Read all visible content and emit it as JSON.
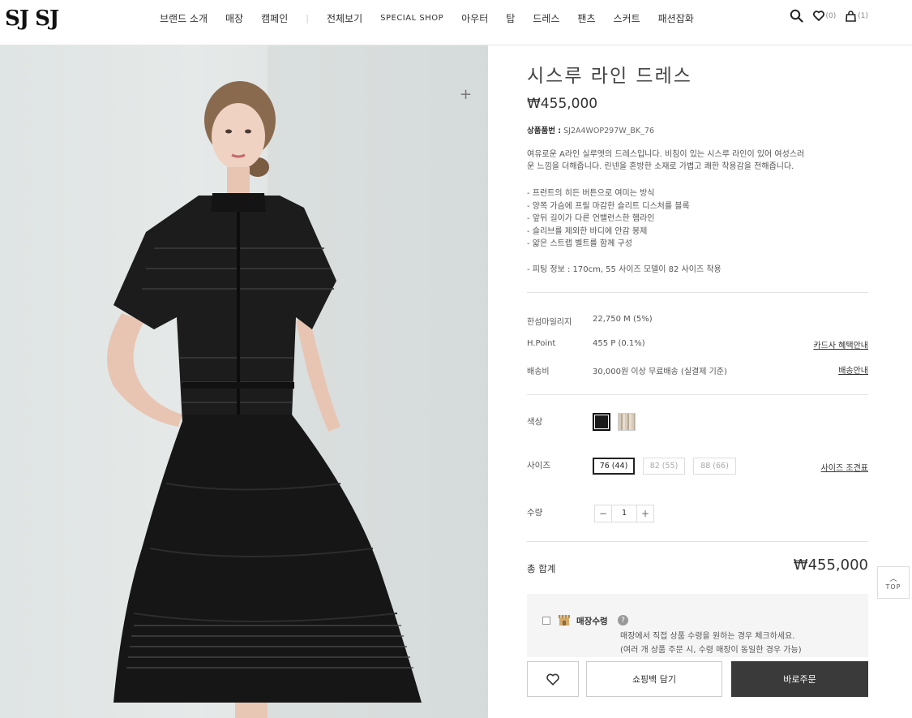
{
  "header": {
    "logo": "SJ SJ",
    "nav": [
      "브랜드 소개",
      "매장",
      "캠페인",
      "전체보기",
      "SPECIAL SHOP",
      "아우터",
      "탑",
      "드레스",
      "팬츠",
      "스커트",
      "패션잡화"
    ],
    "wishlist_count": "(0)",
    "cart_count": "(1)"
  },
  "product": {
    "title": "시스루 라인 드레스",
    "price": "₩455,000",
    "code_label": "상품품번 :",
    "code_value": "SJ2A4WOP297W_BK_76",
    "description": [
      "여유로운 A라인 실루엣의 드레스입니다. 비침이 있는 시스루 라인이 있어 여성스러",
      "운 느낌을 더해줍니다. 린넨을 혼방한 소재로 가볍고 쾌한 착용감을 전해줍니다."
    ],
    "bullets": [
      "- 프런트의 히든 버튼으로 여미는 방식",
      "- 양쪽 가슴에 프릴 마감한 슬리트 디스처를 블록",
      "- 앞뒤 길이가 다른 언밸런스한 헴라인",
      "- 슬리브를 제외한 바디에 안감 봉제",
      "- 얇은 스트랩 벨트를 함께 구성"
    ],
    "fit": "- 피팅 정보 : 170cm, 55 사이즈 모델이 82 사이즈 착용"
  },
  "info": {
    "mileage_label": "한섬마일리지",
    "mileage_value": "22,750 M (5%)",
    "hpoint_label": "H.Point",
    "hpoint_value": "455 P (0.1%)",
    "card_link": "카드사 혜택안내",
    "shipping_label": "배송비",
    "shipping_value": "30,000원 이상 무료배송 (실결제 기준)",
    "shipping_link": "배송안내"
  },
  "options": {
    "color_label": "색상",
    "colors": [
      {
        "name": "black",
        "hex": "#1a1a1a"
      },
      {
        "name": "beige",
        "hex": "#d7cbbb"
      }
    ],
    "size_label": "사이즈",
    "sizes": [
      "76 (44)",
      "82 (55)",
      "88 (66)"
    ],
    "selected_size": "76 (44)",
    "size_chart_link": "사이즈 조견표",
    "qty_label": "수량",
    "qty_minus": "−",
    "qty_value": "1",
    "qty_plus": "+"
  },
  "total": {
    "label": "총 합계",
    "value": "₩455,000"
  },
  "pickup": {
    "title": "매장수령",
    "help": "?",
    "desc_1": "매장에서 직접 상품 수령을 원하는 경우 체크하세요.",
    "desc_2": "(여러 개 상품 주문 시, 수령 매장이 동일한 경우 가능)"
  },
  "actions": {
    "cart": "쇼핑백 담기",
    "buy": "바로주문"
  },
  "top_button": {
    "arrow": "︿",
    "label": "TOP"
  }
}
